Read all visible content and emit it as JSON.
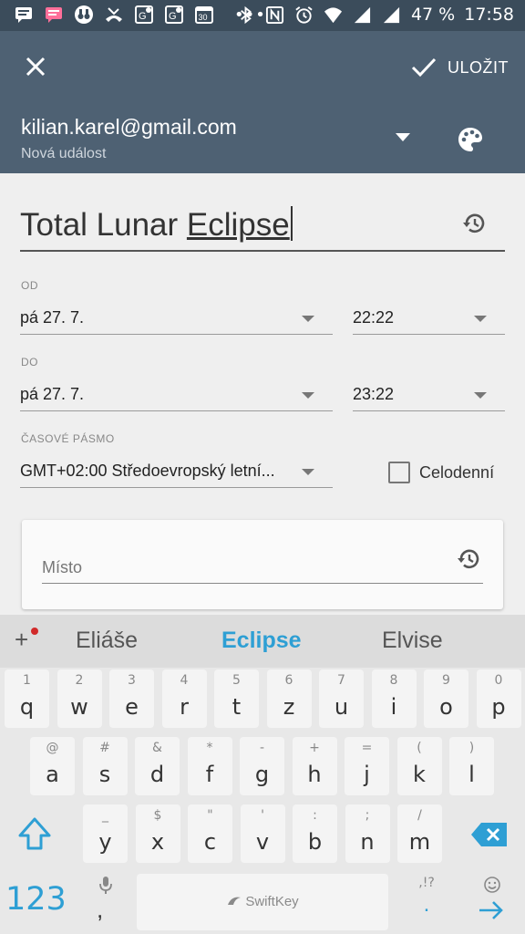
{
  "status_bar": {
    "battery": "47 %",
    "time": "17:58",
    "dots": "•••",
    "left_icons": [
      "message-icon",
      "chat-icon",
      "binoculars-icon",
      "missed-call-icon",
      "maps-icon",
      "maps-icon",
      "calendar-icon"
    ],
    "right_icons": [
      "bluetooth-icon",
      "nfc-icon",
      "alarm-icon",
      "wifi-icon",
      "signal-icon",
      "signal-icon"
    ]
  },
  "appbar": {
    "save_label": "ULOŽIT",
    "account": "kilian.karel@gmail.com",
    "subtitle": "Nová událost",
    "color": "#4e6173"
  },
  "event": {
    "title_prefix": "Total Lunar ",
    "title_word": "Eclipse"
  },
  "from": {
    "label": "OD",
    "date": "pá 27. 7.",
    "time": "22:22"
  },
  "to": {
    "label": "DO",
    "date": "pá 27. 7.",
    "time": "23:22"
  },
  "timezone": {
    "label": "ČASOVÉ PÁSMO",
    "value": "GMT+02:00 Středoevropský letní..."
  },
  "allday": {
    "label": "Celodenní",
    "checked": false
  },
  "place": {
    "placeholder": "Místo"
  },
  "keyboard": {
    "accent": "#2e9fd4",
    "suggestions": [
      "Eliáše",
      "Eclipse",
      "Elvise"
    ],
    "suggest_plus": "+",
    "row1": [
      {
        "sec": "1",
        "pri": "q"
      },
      {
        "sec": "2",
        "pri": "w"
      },
      {
        "sec": "3",
        "pri": "e"
      },
      {
        "sec": "4",
        "pri": "r"
      },
      {
        "sec": "5",
        "pri": "t"
      },
      {
        "sec": "6",
        "pri": "z"
      },
      {
        "sec": "7",
        "pri": "u"
      },
      {
        "sec": "8",
        "pri": "i"
      },
      {
        "sec": "9",
        "pri": "o"
      },
      {
        "sec": "0",
        "pri": "p"
      }
    ],
    "row2": [
      {
        "sec": "@",
        "pri": "a"
      },
      {
        "sec": "#",
        "pri": "s"
      },
      {
        "sec": "&",
        "pri": "d"
      },
      {
        "sec": "*",
        "pri": "f"
      },
      {
        "sec": "-",
        "pri": "g"
      },
      {
        "sec": "+",
        "pri": "h"
      },
      {
        "sec": "=",
        "pri": "j"
      },
      {
        "sec": "(",
        "pri": "k"
      },
      {
        "sec": ")",
        "pri": "l"
      }
    ],
    "row3": [
      {
        "sec": "_",
        "pri": "y"
      },
      {
        "sec": "$",
        "pri": "x"
      },
      {
        "sec": "\"",
        "pri": "c"
      },
      {
        "sec": "'",
        "pri": "v"
      },
      {
        "sec": ":",
        "pri": "b"
      },
      {
        "sec": ";",
        "pri": "n"
      },
      {
        "sec": "/",
        "pri": "m"
      }
    ],
    "numbers_label": "123",
    "comma": ",",
    "space_brand": "SwiftKey",
    "punct_sec": ",!?",
    "punct_pri": "."
  }
}
